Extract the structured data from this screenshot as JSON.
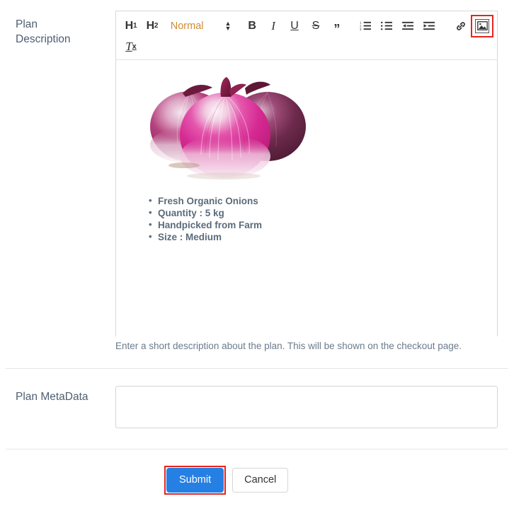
{
  "form": {
    "fields": [
      {
        "label": "Plan Description",
        "help": "Enter a short description about the plan. This will be shown on the checkout page."
      },
      {
        "label": "Plan MetaData",
        "value": "",
        "placeholder": ""
      }
    ]
  },
  "editor": {
    "toolbar": {
      "heading1": "H",
      "heading1_sub": "1",
      "heading2": "H",
      "heading2_sub": "2",
      "format_select": "Normal",
      "bold": "B",
      "italic": "I",
      "underline": "U",
      "strike": "S",
      "blockquote": "”",
      "clear_format": "T",
      "clear_format_sub": "x",
      "items": [
        "h1-button",
        "h2-button",
        "format-select",
        "bold-button",
        "italic-button",
        "underline-button",
        "strikethrough-button",
        "blockquote-button",
        "ordered-list-button",
        "bullet-list-button",
        "outdent-button",
        "indent-button",
        "link-button",
        "image-button",
        "clear-format-button"
      ]
    },
    "content": {
      "image_alt": "Three red onions",
      "bullets": [
        "Fresh Organic Onions",
        "Quantity : 5 kg",
        "Handpicked from Farm",
        "Size : Medium"
      ]
    }
  },
  "actions": {
    "submit": "Submit",
    "cancel": "Cancel"
  },
  "colors": {
    "primary": "#2680e3",
    "highlight": "#e8231e",
    "label": "#4e5f70",
    "body_text": "#5b6b7b",
    "format_select": "#cf8b34"
  }
}
